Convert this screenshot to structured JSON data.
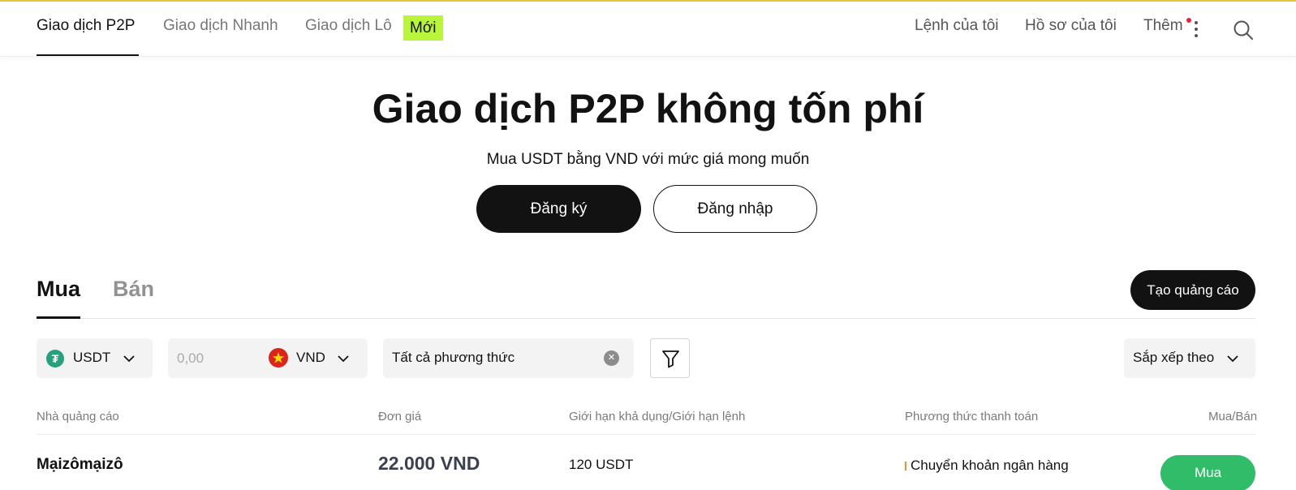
{
  "colors": {
    "top_border": "#e8c43c",
    "new_badge_bg": "#b9f53a",
    "primary_dark": "#121212",
    "buy_green": "#31bc69",
    "usdt_green": "#26a17b",
    "notification_dot": "#e5243b",
    "payment_method_marker": "#ef8e2a"
  },
  "nav": {
    "tabs": [
      {
        "label": "Giao dịch P2P",
        "active": true
      },
      {
        "label": "Giao dịch Nhanh",
        "active": false
      },
      {
        "label": "Giao dịch Lô",
        "active": false
      }
    ],
    "new_badge": "Mới",
    "right": {
      "my_orders": "Lệnh của tôi",
      "my_profile": "Hồ sơ của tôi",
      "more": "Thêm"
    },
    "icons": [
      "kebab-icon",
      "search-icon"
    ]
  },
  "hero": {
    "title": "Giao dịch P2P không tốn phí",
    "subtitle": "Mua USDT bằng VND với mức giá mong muốn",
    "register_label": "Đăng ký",
    "login_label": "Đăng nhập"
  },
  "trade_tabs": {
    "buy": "Mua",
    "sell": "Bán",
    "create_ad": "Tạo quảng cáo"
  },
  "filters": {
    "crypto": "USDT",
    "amount_placeholder": "0,00",
    "fiat": "VND",
    "payment_method": "Tất cả phương thức",
    "sort": "Sắp xếp theo"
  },
  "table": {
    "headers": {
      "advertiser": "Nhà quảng cáo",
      "price": "Đơn giá",
      "limit": "Giới hạn khả dụng/Giới hạn lệnh",
      "payment": "Phương thức thanh toán",
      "action": "Mua/Bán"
    },
    "rows": [
      {
        "advertiser": "Mạizômạizô",
        "price": "22.000 VND",
        "limit": "120 USDT",
        "payment": "Chuyển khoản ngân hàng",
        "action": "Mua"
      }
    ]
  }
}
